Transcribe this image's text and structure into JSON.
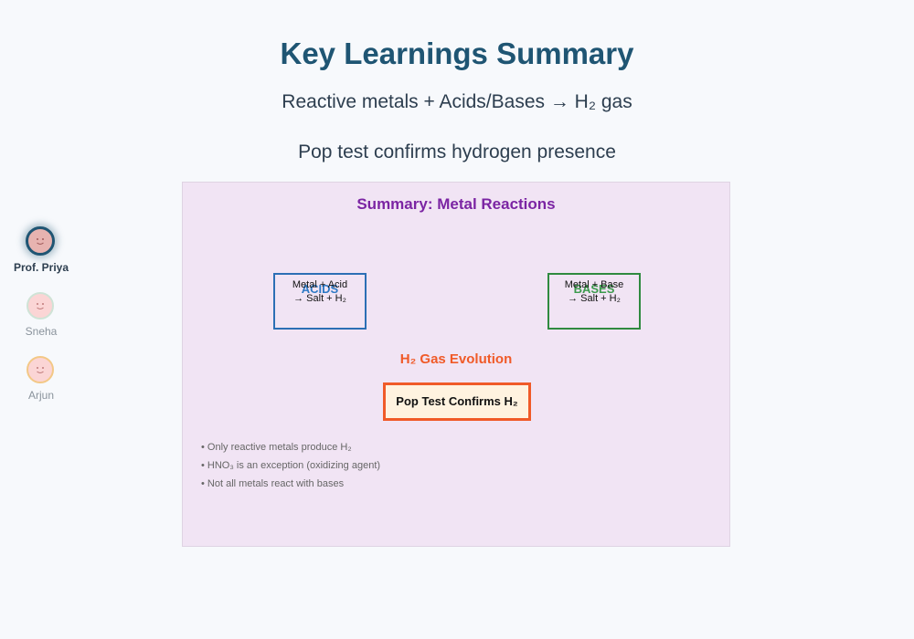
{
  "header": {
    "title": "Key Learnings Summary",
    "subtitle_1": "Reactive metals + Acids/Bases → H₂ gas",
    "subtitle_2": "Pop test confirms hydrogen presence"
  },
  "participants": [
    {
      "name": "Prof. Priya",
      "active": true,
      "ring_color": "#1f5573"
    },
    {
      "name": "Sneha",
      "active": false,
      "ring_color": "#cfe3d6"
    },
    {
      "name": "Arjun",
      "active": false,
      "ring_color": "#f3c886"
    }
  ],
  "board": {
    "title": "Summary: Metal Reactions",
    "acids": {
      "label": "ACIDS",
      "line1": "Metal + Acid",
      "line2": "→ Salt + H₂"
    },
    "bases": {
      "label": "BASES",
      "line1": "Metal + Base",
      "line2": "→ Salt + H₂"
    },
    "evolution_label": "H₂ Gas Evolution",
    "pop_test_label": "Pop Test Confirms H₂",
    "notes": [
      "• Only reactive metals produce H₂",
      "• HNO₃ is an exception (oxidizing agent)",
      "• Not all metals react with bases"
    ]
  },
  "colors": {
    "title": "#1f5573",
    "board_bg": "#f1e4f4",
    "board_title": "#7b24a3",
    "acids": "#2c6fb5",
    "bases": "#2f8a3f",
    "evolution": "#f05a28"
  }
}
